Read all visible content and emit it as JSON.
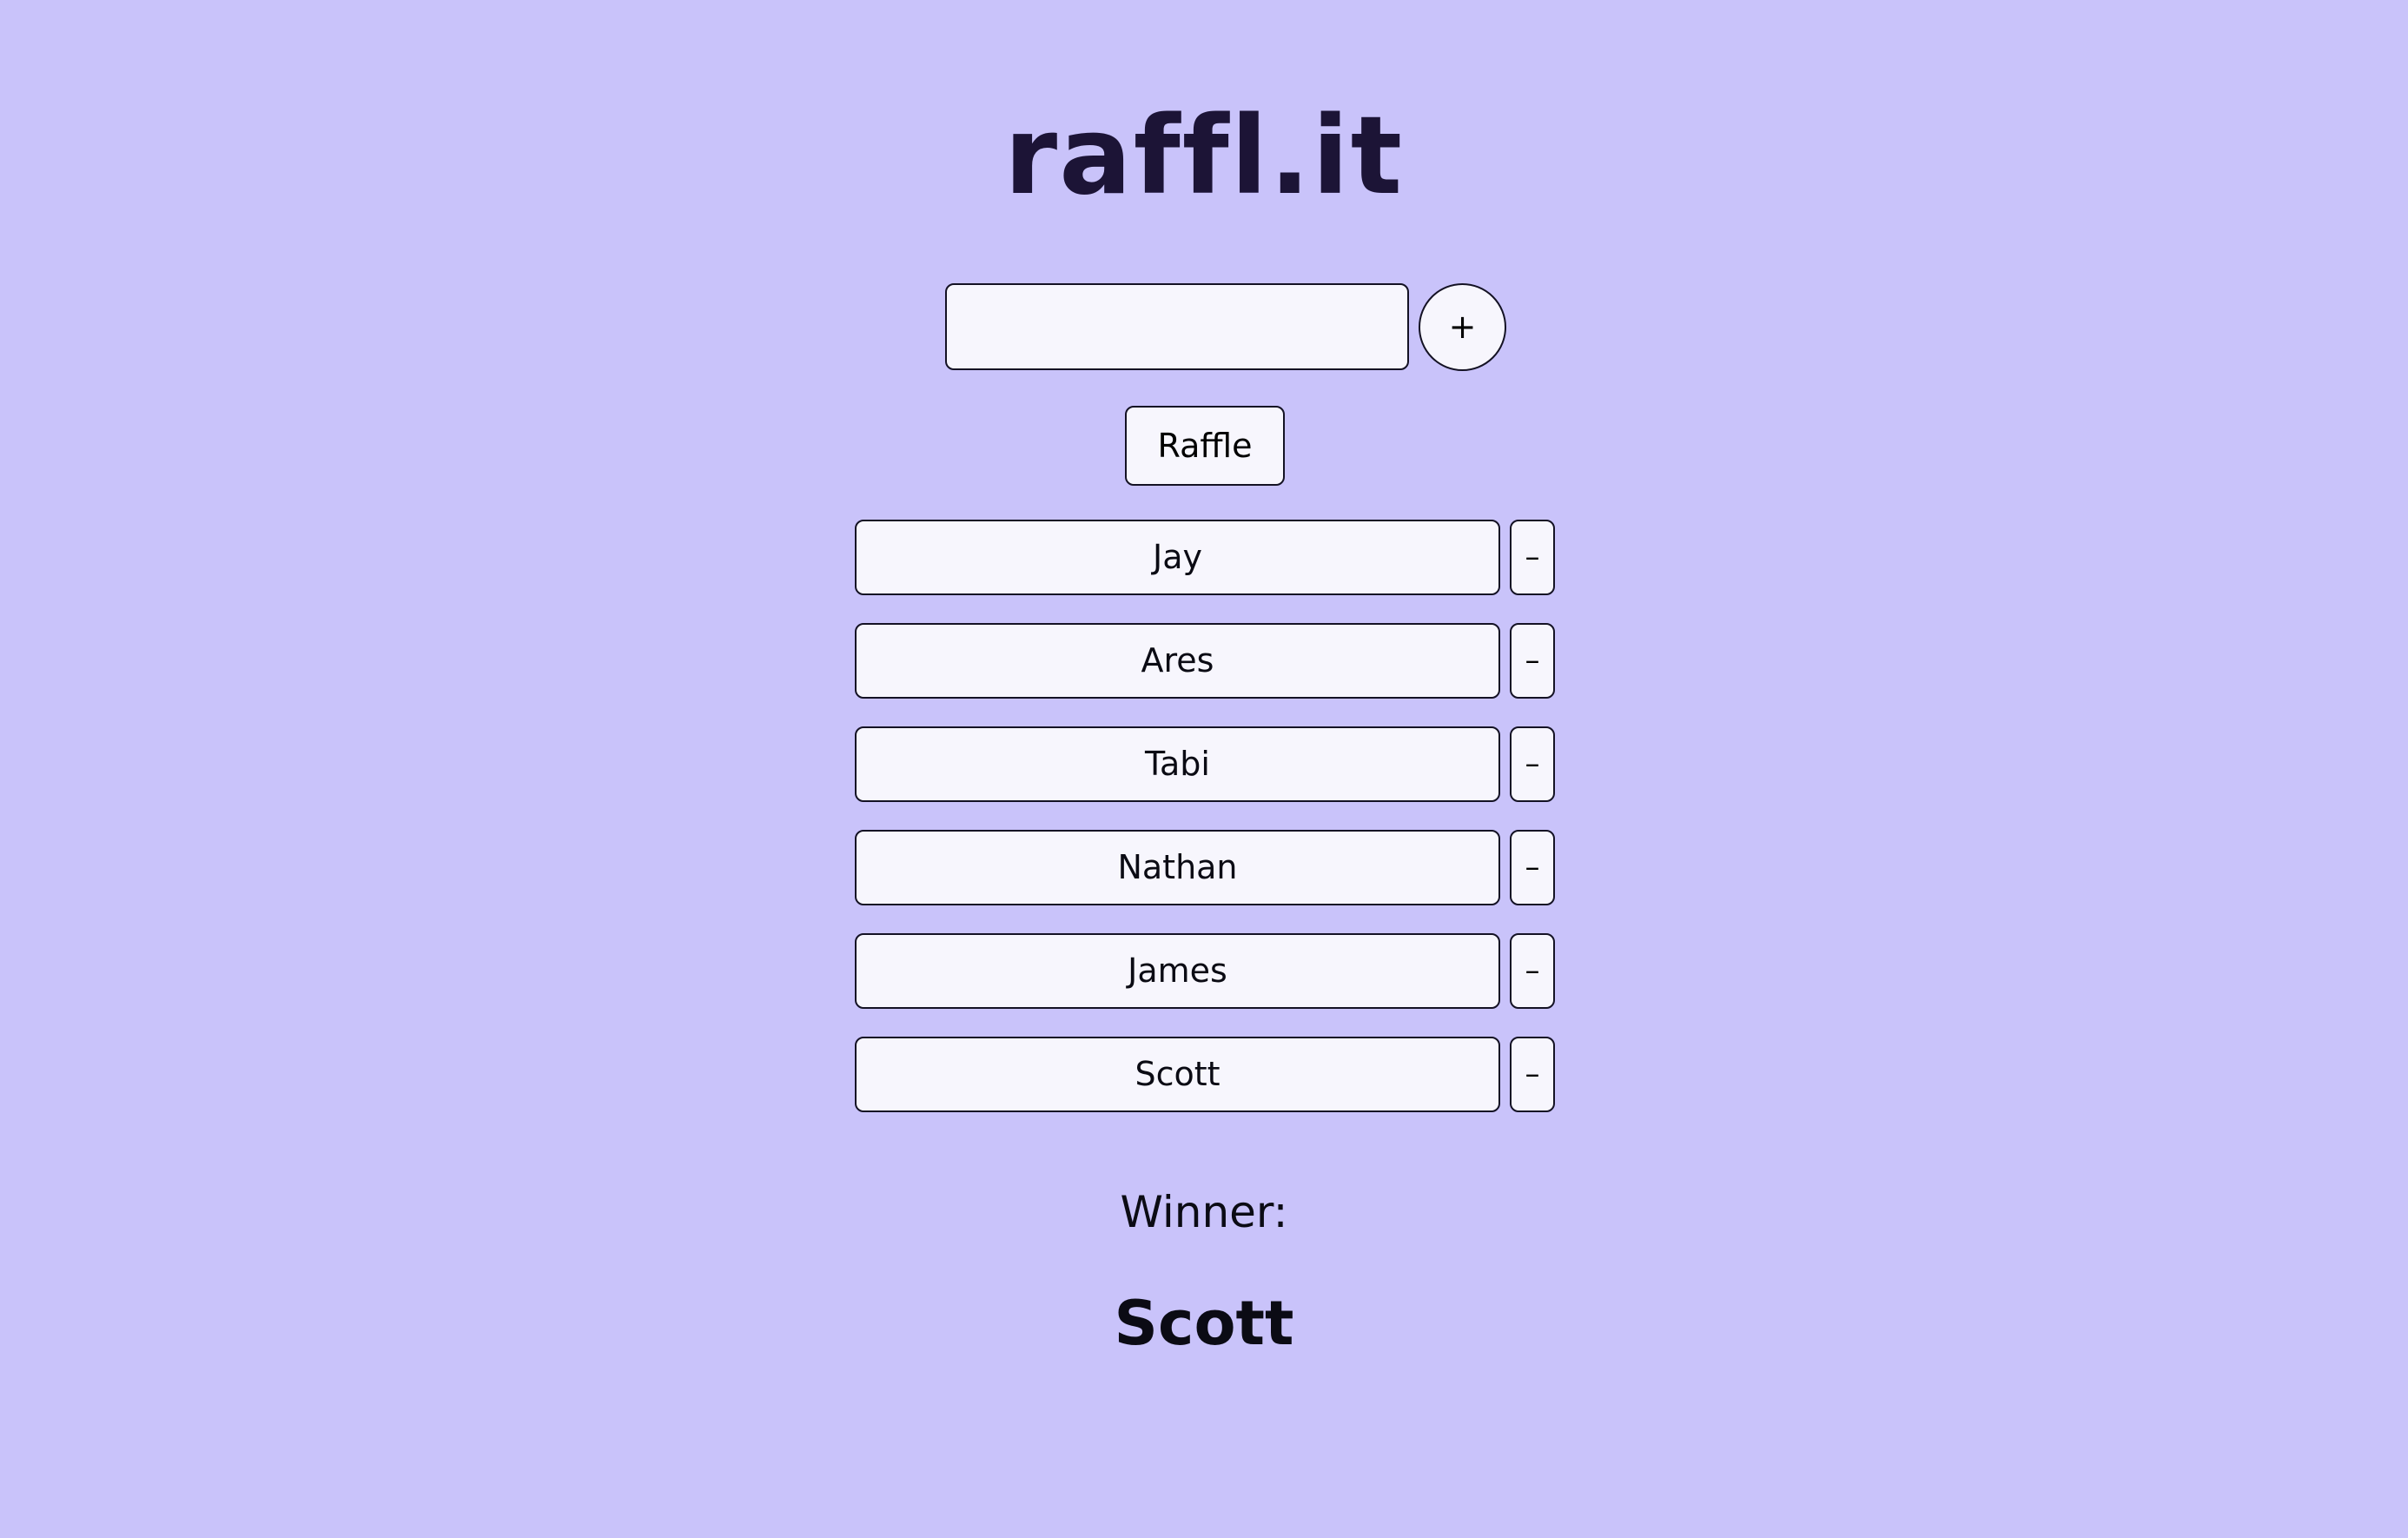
{
  "app": {
    "logo": "raffl.it"
  },
  "entry": {
    "input_value": "",
    "add_label": "+"
  },
  "actions": {
    "raffle_label": "Raffle"
  },
  "entrants": [
    {
      "name": "Jay",
      "remove_label": "–"
    },
    {
      "name": "Ares",
      "remove_label": "–"
    },
    {
      "name": "Tabi",
      "remove_label": "–"
    },
    {
      "name": "Nathan",
      "remove_label": "–"
    },
    {
      "name": "James",
      "remove_label": "–"
    },
    {
      "name": "Scott",
      "remove_label": "–"
    }
  ],
  "result": {
    "label": "Winner:",
    "winner": "Scott"
  },
  "colors": {
    "background": "#c9c3fa",
    "field": "#f7f6fd",
    "logo": "#1c1436",
    "border": "#141224"
  }
}
